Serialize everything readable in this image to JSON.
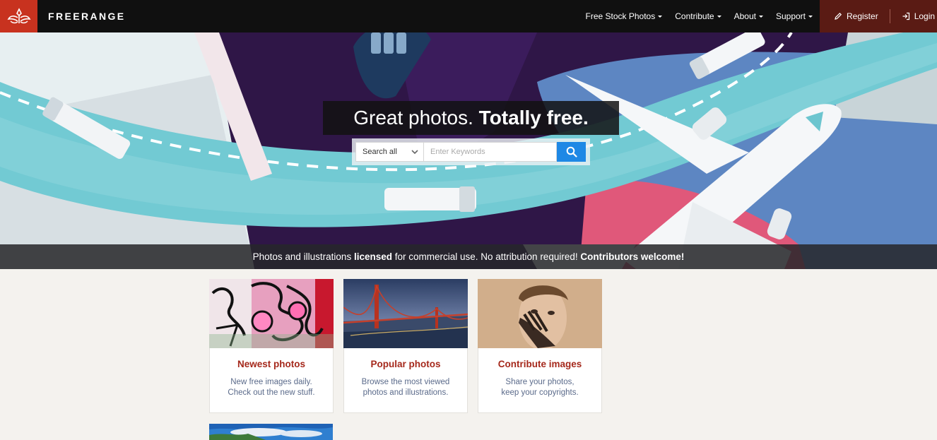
{
  "nav": {
    "brand": "FREERANGE",
    "logo_icon": "freerange-logo-icon",
    "menu": [
      {
        "label": "Free Stock Photos"
      },
      {
        "label": "Contribute"
      },
      {
        "label": "About"
      },
      {
        "label": "Support"
      }
    ],
    "register": "Register",
    "login": "Login"
  },
  "hero": {
    "headline_light": "Great photos. ",
    "headline_bold": "Totally free.",
    "search": {
      "select_value": "Search all",
      "placeholder": "Enter Keywords"
    },
    "tagline": {
      "part1": "Photos and illustrations ",
      "bold1": "licensed",
      "part2": " for commercial use. No attribution required! ",
      "bold2": "Contributors welcome!"
    }
  },
  "cards": [
    {
      "title": "Newest photos",
      "desc1": "New free images daily.",
      "desc2": "Check out the new stuff."
    },
    {
      "title": "Popular photos",
      "desc1": "Browse the most viewed",
      "desc2": "photos and illustrations."
    },
    {
      "title": "Contribute images",
      "desc1": "Share your photos,",
      "desc2": "keep your copyrights."
    }
  ],
  "colors": {
    "brand_red": "#c8321f",
    "auth_bg": "#5a1b14",
    "card_title": "#a5281b",
    "search_button": "#1e88e5"
  }
}
